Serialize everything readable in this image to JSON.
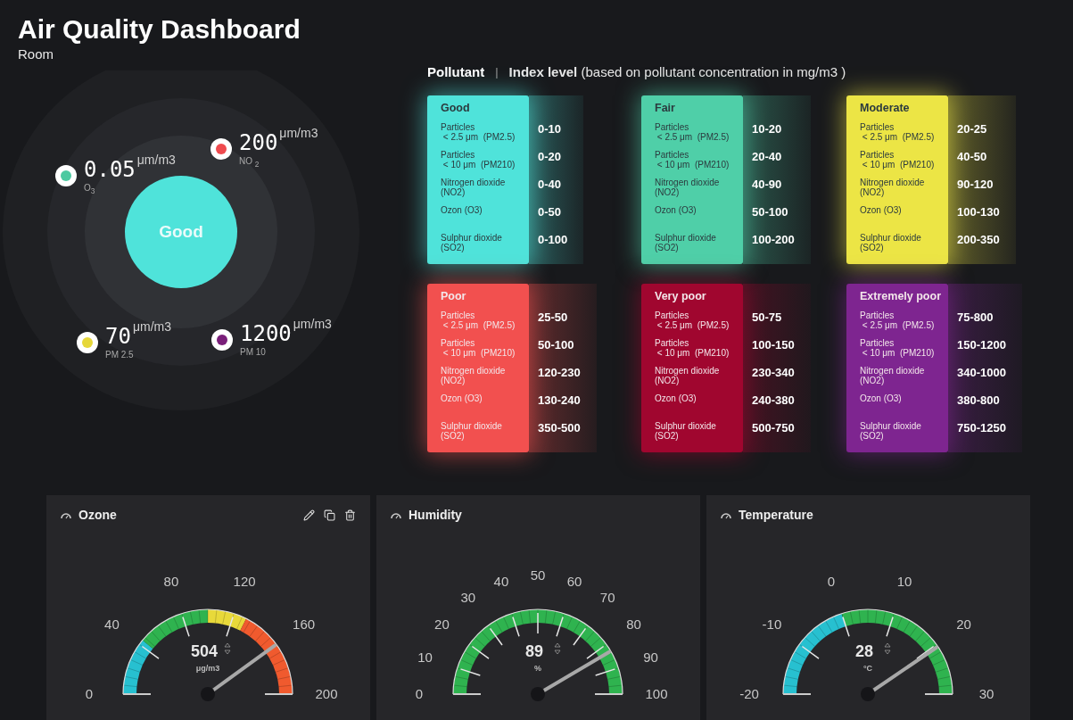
{
  "title": "Air Quality Dashboard",
  "subtitle": "Room",
  "status": {
    "label": "Good",
    "color": "#4fe3da"
  },
  "readings": [
    {
      "value": "0.05",
      "unit": "μm/m3",
      "label": "O$_{3}$",
      "color": "#4cc9a0"
    },
    {
      "value": "200",
      "unit": "μm/m3",
      "label": "NO $_{2}$",
      "color": "#ef4b4f"
    },
    {
      "value": "70",
      "unit": "μm/m3",
      "label": "PM 2.5",
      "color": "#e6d73a"
    },
    {
      "value": "1200",
      "unit": "μm/m3",
      "label": "PM 10",
      "color": "#7a1f7a"
    }
  ],
  "legend_header": {
    "left": "Pollutant",
    "separator": "|",
    "right": "**Index level** (based on pollutant concentration in mg/m3 )"
  },
  "levels": [
    {
      "name": "Good",
      "color": "#4fe3da",
      "rows": [
        {
          "pollutant": "Particles\n < 2.5 μm  (PM2.5)",
          "range": "0-10"
        },
        {
          "pollutant": "Particles\n < 10 μm  (PM210)",
          "range": "0-20"
        },
        {
          "pollutant": "Nitrogen dioxide\n(NO2)",
          "range": "0-40"
        },
        {
          "pollutant": "Ozon (O3)",
          "range": "0-50"
        },
        {
          "pollutant": "Sulphur dioxide\n(SO2)",
          "range": "0-100"
        }
      ]
    },
    {
      "name": "Fair",
      "color": "#4fcfa8",
      "rows": [
        {
          "pollutant": "Particles\n < 2.5 μm  (PM2.5)",
          "range": "10-20"
        },
        {
          "pollutant": "Particles\n < 10 μm  (PM210)",
          "range": "20-40"
        },
        {
          "pollutant": "Nitrogen dioxide\n(NO2)",
          "range": "40-90"
        },
        {
          "pollutant": "Ozon (O3)",
          "range": "50-100"
        },
        {
          "pollutant": "Sulphur dioxide\n(SO2)",
          "range": "100-200"
        }
      ]
    },
    {
      "name": "Moderate",
      "color": "#ece545",
      "rows": [
        {
          "pollutant": "Particles\n < 2.5 μm  (PM2.5)",
          "range": "20-25"
        },
        {
          "pollutant": "Particles\n < 10 μm  (PM210)",
          "range": "40-50"
        },
        {
          "pollutant": "Nitrogen dioxide\n(NO2)",
          "range": "90-120"
        },
        {
          "pollutant": "Ozon (O3)",
          "range": "100-130"
        },
        {
          "pollutant": "Sulphur dioxide\n(SO2)",
          "range": "200-350"
        }
      ]
    },
    {
      "name": "Poor",
      "color": "#f2504f",
      "rows": [
        {
          "pollutant": "Particles\n < 2.5 μm  (PM2.5)",
          "range": "25-50"
        },
        {
          "pollutant": "Particles\n < 10 μm  (PM210)",
          "range": "50-100"
        },
        {
          "pollutant": "Nitrogen dioxide\n(NO2)",
          "range": "120-230"
        },
        {
          "pollutant": "Ozon (O3)",
          "range": "130-240"
        },
        {
          "pollutant": "Sulphur dioxide\n(SO2)",
          "range": "350-500"
        }
      ]
    },
    {
      "name": "Very poor",
      "color": "#a0062f",
      "rows": [
        {
          "pollutant": "Particles\n < 2.5 μm  (PM2.5)",
          "range": "50-75"
        },
        {
          "pollutant": "Particles\n < 10 μm  (PM210)",
          "range": "100-150"
        },
        {
          "pollutant": "Nitrogen dioxide\n(NO2)",
          "range": "230-340"
        },
        {
          "pollutant": "Ozon (O3)",
          "range": "240-380"
        },
        {
          "pollutant": "Sulphur dioxide\n(SO2)",
          "range": "500-750"
        }
      ]
    },
    {
      "name": "Extremely poor",
      "color": "#7e2590",
      "rows": [
        {
          "pollutant": "Particles\n < 2.5 μm  (PM2.5)",
          "range": "75-800"
        },
        {
          "pollutant": "Particles\n < 10 μm  (PM210)",
          "range": "150-1200"
        },
        {
          "pollutant": "Nitrogen dioxide\n(NO2)",
          "range": "340-1000"
        },
        {
          "pollutant": "Ozon (O3)",
          "range": "380-800"
        },
        {
          "pollutant": "Sulphur dioxide\n(SO2)",
          "range": "750-1250"
        }
      ]
    }
  ],
  "gauges": [
    {
      "title": "Ozone",
      "actions": true,
      "value": "504",
      "unit": "μg/m3",
      "ticks": [
        "0",
        "40",
        "80",
        "120",
        "160",
        "200"
      ],
      "bands": [
        {
          "color": "#27c0d0"
        },
        {
          "color": "#2fb34f"
        },
        {
          "color": "#e8d93a"
        },
        {
          "color": "#f05a2e"
        }
      ]
    },
    {
      "title": "Humidity",
      "actions": false,
      "value": "89",
      "unit": "%",
      "ticks": [
        "0",
        "10",
        "20",
        "30",
        "40",
        "50",
        "60",
        "70",
        "80",
        "90",
        "100"
      ],
      "bands": [
        {
          "color": "#2fb34f"
        }
      ]
    },
    {
      "title": "Temperature",
      "actions": false,
      "value": "28",
      "unit": "°C",
      "ticks": [
        "-20",
        "-10",
        "0",
        "10",
        "20",
        "30"
      ],
      "bands": [
        {
          "color": "#27c0d0"
        },
        {
          "color": "#2fb34f"
        }
      ]
    }
  ]
}
